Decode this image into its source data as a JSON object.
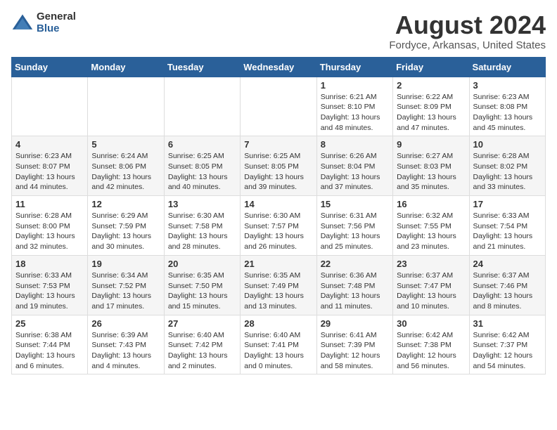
{
  "logo": {
    "general": "General",
    "blue": "Blue"
  },
  "header": {
    "title": "August 2024",
    "subtitle": "Fordyce, Arkansas, United States"
  },
  "days_of_week": [
    "Sunday",
    "Monday",
    "Tuesday",
    "Wednesday",
    "Thursday",
    "Friday",
    "Saturday"
  ],
  "weeks": [
    [
      {
        "day": "",
        "info": ""
      },
      {
        "day": "",
        "info": ""
      },
      {
        "day": "",
        "info": ""
      },
      {
        "day": "",
        "info": ""
      },
      {
        "day": "1",
        "info": "Sunrise: 6:21 AM\nSunset: 8:10 PM\nDaylight: 13 hours and 48 minutes."
      },
      {
        "day": "2",
        "info": "Sunrise: 6:22 AM\nSunset: 8:09 PM\nDaylight: 13 hours and 47 minutes."
      },
      {
        "day": "3",
        "info": "Sunrise: 6:23 AM\nSunset: 8:08 PM\nDaylight: 13 hours and 45 minutes."
      }
    ],
    [
      {
        "day": "4",
        "info": "Sunrise: 6:23 AM\nSunset: 8:07 PM\nDaylight: 13 hours and 44 minutes."
      },
      {
        "day": "5",
        "info": "Sunrise: 6:24 AM\nSunset: 8:06 PM\nDaylight: 13 hours and 42 minutes."
      },
      {
        "day": "6",
        "info": "Sunrise: 6:25 AM\nSunset: 8:05 PM\nDaylight: 13 hours and 40 minutes."
      },
      {
        "day": "7",
        "info": "Sunrise: 6:25 AM\nSunset: 8:05 PM\nDaylight: 13 hours and 39 minutes."
      },
      {
        "day": "8",
        "info": "Sunrise: 6:26 AM\nSunset: 8:04 PM\nDaylight: 13 hours and 37 minutes."
      },
      {
        "day": "9",
        "info": "Sunrise: 6:27 AM\nSunset: 8:03 PM\nDaylight: 13 hours and 35 minutes."
      },
      {
        "day": "10",
        "info": "Sunrise: 6:28 AM\nSunset: 8:02 PM\nDaylight: 13 hours and 33 minutes."
      }
    ],
    [
      {
        "day": "11",
        "info": "Sunrise: 6:28 AM\nSunset: 8:00 PM\nDaylight: 13 hours and 32 minutes."
      },
      {
        "day": "12",
        "info": "Sunrise: 6:29 AM\nSunset: 7:59 PM\nDaylight: 13 hours and 30 minutes."
      },
      {
        "day": "13",
        "info": "Sunrise: 6:30 AM\nSunset: 7:58 PM\nDaylight: 13 hours and 28 minutes."
      },
      {
        "day": "14",
        "info": "Sunrise: 6:30 AM\nSunset: 7:57 PM\nDaylight: 13 hours and 26 minutes."
      },
      {
        "day": "15",
        "info": "Sunrise: 6:31 AM\nSunset: 7:56 PM\nDaylight: 13 hours and 25 minutes."
      },
      {
        "day": "16",
        "info": "Sunrise: 6:32 AM\nSunset: 7:55 PM\nDaylight: 13 hours and 23 minutes."
      },
      {
        "day": "17",
        "info": "Sunrise: 6:33 AM\nSunset: 7:54 PM\nDaylight: 13 hours and 21 minutes."
      }
    ],
    [
      {
        "day": "18",
        "info": "Sunrise: 6:33 AM\nSunset: 7:53 PM\nDaylight: 13 hours and 19 minutes."
      },
      {
        "day": "19",
        "info": "Sunrise: 6:34 AM\nSunset: 7:52 PM\nDaylight: 13 hours and 17 minutes."
      },
      {
        "day": "20",
        "info": "Sunrise: 6:35 AM\nSunset: 7:50 PM\nDaylight: 13 hours and 15 minutes."
      },
      {
        "day": "21",
        "info": "Sunrise: 6:35 AM\nSunset: 7:49 PM\nDaylight: 13 hours and 13 minutes."
      },
      {
        "day": "22",
        "info": "Sunrise: 6:36 AM\nSunset: 7:48 PM\nDaylight: 13 hours and 11 minutes."
      },
      {
        "day": "23",
        "info": "Sunrise: 6:37 AM\nSunset: 7:47 PM\nDaylight: 13 hours and 10 minutes."
      },
      {
        "day": "24",
        "info": "Sunrise: 6:37 AM\nSunset: 7:46 PM\nDaylight: 13 hours and 8 minutes."
      }
    ],
    [
      {
        "day": "25",
        "info": "Sunrise: 6:38 AM\nSunset: 7:44 PM\nDaylight: 13 hours and 6 minutes."
      },
      {
        "day": "26",
        "info": "Sunrise: 6:39 AM\nSunset: 7:43 PM\nDaylight: 13 hours and 4 minutes."
      },
      {
        "day": "27",
        "info": "Sunrise: 6:40 AM\nSunset: 7:42 PM\nDaylight: 13 hours and 2 minutes."
      },
      {
        "day": "28",
        "info": "Sunrise: 6:40 AM\nSunset: 7:41 PM\nDaylight: 13 hours and 0 minutes."
      },
      {
        "day": "29",
        "info": "Sunrise: 6:41 AM\nSunset: 7:39 PM\nDaylight: 12 hours and 58 minutes."
      },
      {
        "day": "30",
        "info": "Sunrise: 6:42 AM\nSunset: 7:38 PM\nDaylight: 12 hours and 56 minutes."
      },
      {
        "day": "31",
        "info": "Sunrise: 6:42 AM\nSunset: 7:37 PM\nDaylight: 12 hours and 54 minutes."
      }
    ]
  ]
}
